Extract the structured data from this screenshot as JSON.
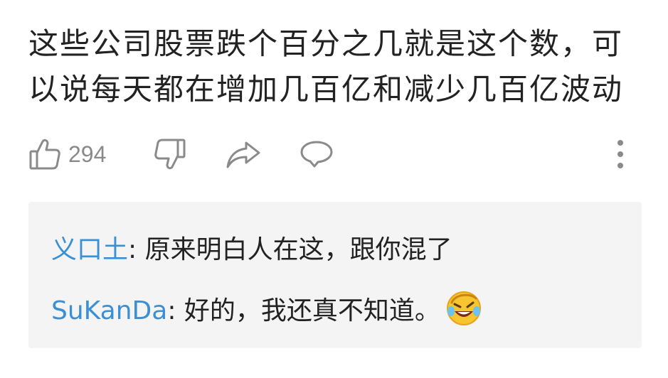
{
  "comment": {
    "text": "这些公司股票跌个百分之几就是这个数，可以说每天都在增加几百亿和减少几百亿波动"
  },
  "actions": {
    "like_count": "294",
    "like_icon": "thumbs-up-icon",
    "dislike_icon": "thumbs-down-icon",
    "share_icon": "share-arrow-icon",
    "reply_icon": "speech-bubble-icon",
    "more_icon": "vertical-dots-icon"
  },
  "replies": [
    {
      "author": "义口土",
      "separator": ": ",
      "text": "原来明白人在这，跟你混了"
    },
    {
      "author": "SuKanDa",
      "separator": ": ",
      "text": "好的，我还真不知道。",
      "emoji": "laughing-crying-emoji"
    }
  ],
  "colors": {
    "author": "#3b8fd5",
    "text": "#222222",
    "icon": "#8a8a8a",
    "reply_bg": "#f4f4f4"
  }
}
